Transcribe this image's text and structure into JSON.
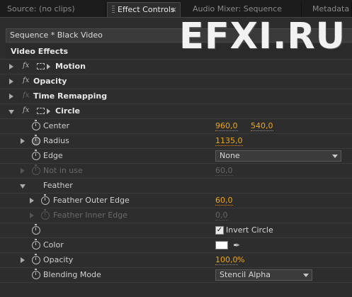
{
  "tabs": [
    {
      "label": "Source: (no clips)",
      "active": false
    },
    {
      "label": "Effect Controls",
      "active": true,
      "close": "×"
    },
    {
      "label": "Audio Mixer: Sequence",
      "active": false
    },
    {
      "label": "Metadata",
      "active": false
    }
  ],
  "sequence_label": "Sequence * Black Video",
  "section_header": "Video Effects",
  "effects": {
    "motion": "Motion",
    "opacity": "Opacity",
    "time_remapping": "Time Remapping",
    "circle": "Circle"
  },
  "fx_glyph": "fx",
  "circle_props": {
    "center_label": "Center",
    "center_x": "960,0",
    "center_y": "540,0",
    "radius_label": "Radius",
    "radius_value": "1135,0",
    "edge_label": "Edge",
    "edge_value": "None",
    "not_in_use_label": "Not in use",
    "not_in_use_value": "60,0",
    "feather_label": "Feather",
    "feather_outer_label": "Feather Outer Edge",
    "feather_outer_value": "60,0",
    "feather_inner_label": "Feather Inner Edge",
    "feather_inner_value": "0,0",
    "invert_label": "Invert Circle",
    "invert_checked": true,
    "check_glyph": "✓",
    "color_label": "Color",
    "color_value": "#ffffff",
    "opacity_label": "Opacity",
    "opacity_value": "100,0",
    "opacity_unit": "%",
    "blend_label": "Blending Mode",
    "blend_value": "Stencil Alpha"
  },
  "watermark": "EFXI.RU",
  "colors": {
    "value_orange": "#f0a70a",
    "panel_bg": "#2d2d2d",
    "tab_bg": "#1c1c1c"
  }
}
